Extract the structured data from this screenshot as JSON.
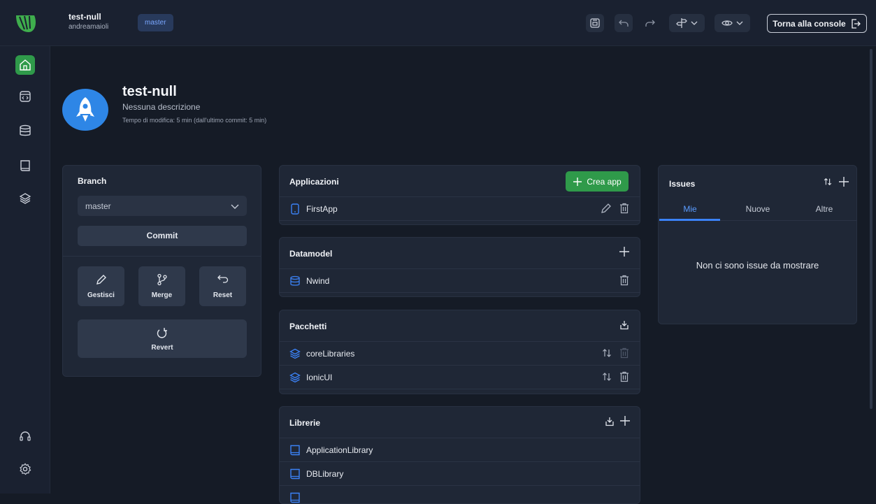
{
  "header": {
    "project_name": "test-null",
    "owner": "andreamaioli",
    "branch": "master",
    "console_button": "Torna alla console"
  },
  "project": {
    "title": "test-null",
    "description": "Nessuna descrizione",
    "edit_time": "Tempo di modifica: 5 min (dall'ultimo commit: 5 min)"
  },
  "branch_card": {
    "title": "Branch",
    "selected": "master",
    "commit": "Commit",
    "manage": "Gestisci",
    "merge": "Merge",
    "reset": "Reset",
    "revert": "Revert"
  },
  "apps": {
    "title": "Applicazioni",
    "create_label": "Crea app",
    "items": [
      {
        "label": "FirstApp"
      }
    ]
  },
  "datamodel": {
    "title": "Datamodel",
    "items": [
      {
        "label": "Nwind"
      }
    ]
  },
  "packages": {
    "title": "Pacchetti",
    "items": [
      {
        "label": "coreLibraries"
      },
      {
        "label": "IonicUI"
      }
    ]
  },
  "libraries": {
    "title": "Librerie",
    "items": [
      {
        "label": "ApplicationLibrary"
      },
      {
        "label": "DBLibrary"
      }
    ]
  },
  "issues": {
    "title": "Issues",
    "tabs": [
      {
        "label": "Mie"
      },
      {
        "label": "Nuove"
      },
      {
        "label": "Altre"
      }
    ],
    "empty": "Non ci sono issue da mostrare"
  },
  "colors": {
    "background": "#151b26",
    "panel": "#1f2736",
    "accent_green": "#2f9a4a",
    "accent_blue": "#3b82f6"
  }
}
